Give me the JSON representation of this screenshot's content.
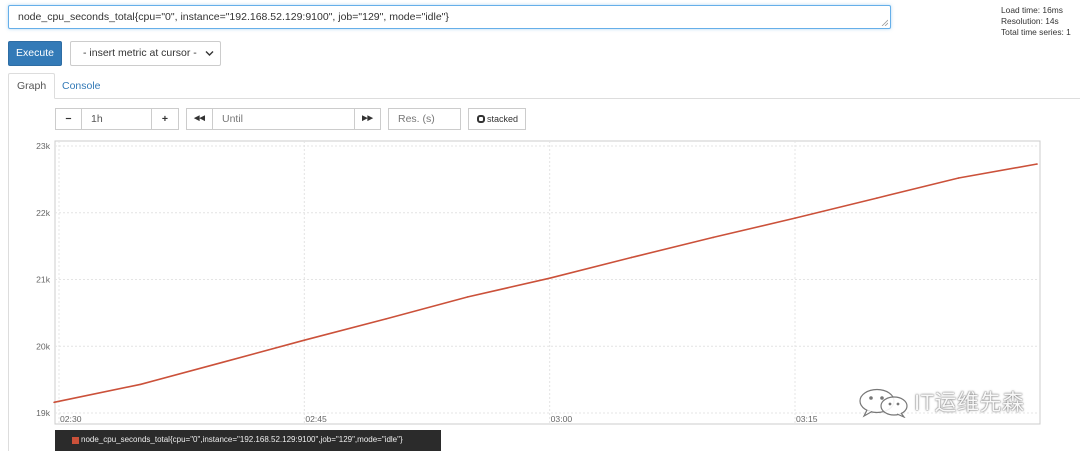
{
  "query": {
    "expression": "node_cpu_seconds_total{cpu=\"0\", instance=\"192.168.52.129:9100\", job=\"129\", mode=\"idle\"}"
  },
  "stats": {
    "load_time": "Load time: 16ms",
    "resolution": "Resolution: 14s",
    "total_series": "Total time series: 1"
  },
  "toolbar": {
    "execute_label": "Execute",
    "metric_select_value": "- insert metric at cursor -"
  },
  "tabs": [
    {
      "label": "Graph",
      "active": true
    },
    {
      "label": "Console",
      "active": false
    }
  ],
  "graph_controls": {
    "minus_label": "−",
    "range_value": "1h",
    "plus_label": "+",
    "back_label": "◀◀",
    "until_placeholder": "Until",
    "forward_label": "▶▶",
    "resolution_placeholder": "Res. (s)",
    "stacked_label": "stacked"
  },
  "legend": {
    "series_label": "node_cpu_seconds_total{cpu=\"0\",instance=\"192.168.52.129:9100\",job=\"129\",mode=\"idle\"}",
    "color": "#cb513a"
  },
  "watermark": {
    "text": "IT运维先森"
  },
  "chart_data": {
    "type": "line",
    "title": "",
    "xlabel": "",
    "ylabel": "",
    "x_ticks": [
      "02:30",
      "02:45",
      "03:00",
      "03:15"
    ],
    "y_ticks": [
      "19k",
      "20k",
      "21k",
      "22k",
      "23k"
    ],
    "xlim": [
      "02:29.7",
      "03:29.8"
    ],
    "ylim": [
      19000,
      23100
    ],
    "grid": true,
    "legend_position": "bottom",
    "series": [
      {
        "name": "node_cpu_seconds_total{cpu=\"0\",instance=\"192.168.52.129:9100\",job=\"129\",mode=\"idle\"}",
        "color": "#cb513a",
        "x": [
          "02:29.7",
          "02:35",
          "02:40",
          "02:45",
          "02:50",
          "02:55",
          "03:00",
          "03:05",
          "03:10",
          "03:15",
          "03:20",
          "03:25",
          "03:29.8"
        ],
        "y": [
          19160,
          19430,
          19760,
          20090,
          20410,
          20740,
          21020,
          21330,
          21630,
          21920,
          22220,
          22520,
          22730
        ]
      }
    ]
  }
}
